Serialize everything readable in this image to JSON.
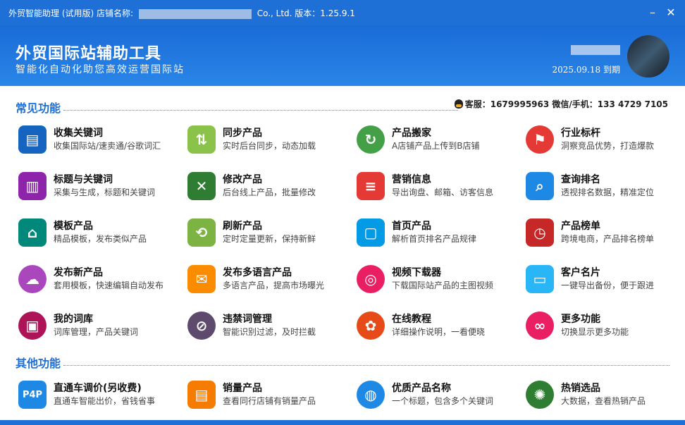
{
  "window": {
    "title_prefix": "外贸智能助理 (试用版) 店铺名称:",
    "title_suffix": "Co., Ltd.  版本：1.25.9.1",
    "minimize": "–",
    "close": "✕"
  },
  "header": {
    "app_title": "外贸国际站辅助工具",
    "slogan": "智能化自动化助您高效运营国际站",
    "expiry": "2025.09.18 到期"
  },
  "sections": {
    "common": "常见功能",
    "other": "其他功能"
  },
  "contact": "客服：1679995963  微信/手机：133 4729 7105",
  "colors": {
    "brand": "#1e6fd6"
  },
  "features": [
    {
      "name": "收集关键词",
      "desc": "收集国际站/速卖通/谷歌词汇",
      "icon": "folder-icon",
      "color": "#1565c0",
      "glyph": "▤"
    },
    {
      "name": "同步产品",
      "desc": "实时后台同步，动态加载",
      "icon": "cloud-sync-icon",
      "color": "#8bc34a",
      "glyph": "⇅"
    },
    {
      "name": "产品搬家",
      "desc": "A店铺产品上传到B店铺",
      "icon": "move-icon",
      "color": "#43a047",
      "glyph": "↻"
    },
    {
      "name": "行业标杆",
      "desc": "洞察竞品优势，打造爆款",
      "icon": "flag-icon",
      "color": "#e53935",
      "glyph": "⚑"
    },
    {
      "name": "标题与关键词",
      "desc": "采集与生成，标题和关键词",
      "icon": "building-icon",
      "color": "#8e24aa",
      "glyph": "▥"
    },
    {
      "name": "修改产品",
      "desc": "后台线上产品，批量修改",
      "icon": "tools-icon",
      "color": "#2e7d32",
      "glyph": "✕"
    },
    {
      "name": "营销信息",
      "desc": "导出询盘、邮箱、访客信息",
      "icon": "document-icon",
      "color": "#e53935",
      "glyph": "≡"
    },
    {
      "name": "查询排名",
      "desc": "透视排名数据，精准定位",
      "icon": "search-icon",
      "color": "#1e88e5",
      "glyph": "⌕"
    },
    {
      "name": "模板产品",
      "desc": "精品模板，发布类似产品",
      "icon": "template-icon",
      "color": "#00897b",
      "glyph": "⌂"
    },
    {
      "name": "刷新产品",
      "desc": "定时定量更新，保持新鲜",
      "icon": "refresh-icon",
      "color": "#7cb342",
      "glyph": "⟲"
    },
    {
      "name": "首页产品",
      "desc": "解析首页排名产品规律",
      "icon": "homepage-icon",
      "color": "#039be5",
      "glyph": "▢"
    },
    {
      "name": "产品榜单",
      "desc": "跨境电商，产品排名榜单",
      "icon": "clock-icon",
      "color": "#c62828",
      "glyph": "◷"
    },
    {
      "name": "发布新产品",
      "desc": "套用模板，快速编辑自动发布",
      "icon": "cloud-upload-icon",
      "color": "#ab47bc",
      "glyph": "☁"
    },
    {
      "name": "发布多语言产品",
      "desc": "多语言产品，提高市场曝光",
      "icon": "house-mail-icon",
      "color": "#fb8c00",
      "glyph": "✉"
    },
    {
      "name": "视频下载器",
      "desc": "下载国际站产品的主图视频",
      "icon": "lifebuoy-icon",
      "color": "#e91e63",
      "glyph": "◎"
    },
    {
      "name": "客户名片",
      "desc": "一键导出备份，便于跟进",
      "icon": "card-icon",
      "color": "#29b6f6",
      "glyph": "▭"
    },
    {
      "name": "我的词库",
      "desc": "词库管理，产品关键词",
      "icon": "monitor-icon",
      "color": "#ad1457",
      "glyph": "▣"
    },
    {
      "name": "违禁词管理",
      "desc": "智能识别过滤，及时拦截",
      "icon": "ban-icon",
      "color": "#5d4a6d",
      "glyph": "⊘"
    },
    {
      "name": "在线教程",
      "desc": "详细操作说明，一看便晓",
      "icon": "handshake-icon",
      "color": "#e64a19",
      "glyph": "✿"
    },
    {
      "name": "更多功能",
      "desc": "切换显示更多功能",
      "icon": "link-icon",
      "color": "#e91e63",
      "glyph": "∞"
    }
  ],
  "other_features": [
    {
      "name": "直通车调价(另收费)",
      "desc": "直通车智能出价，省钱省事",
      "icon": "p4p-icon",
      "color": "#1e88e5",
      "glyph": "P4P"
    },
    {
      "name": "销量产品",
      "desc": "查看同行店铺有销量产品",
      "icon": "notebook-icon",
      "color": "#f57c00",
      "glyph": "▤"
    },
    {
      "name": "优质产品名称",
      "desc": "一个标题，包含多个关键词",
      "icon": "globe-icon",
      "color": "#1e88e5",
      "glyph": "◍"
    },
    {
      "name": "热销选品",
      "desc": "大数据，查看热销产品",
      "icon": "wheel-icon",
      "color": "#2e7d32",
      "glyph": "✺"
    }
  ]
}
